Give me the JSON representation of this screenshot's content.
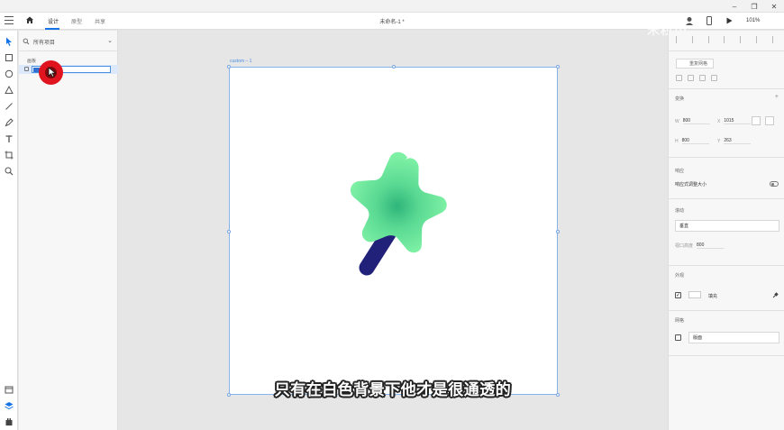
{
  "titlebar": {
    "window_controls": [
      "minimize-icon",
      "maximize-icon",
      "close-icon"
    ]
  },
  "menubar": {
    "tabs": [
      {
        "label": "设计",
        "active": true
      },
      {
        "label": "原型",
        "active": false
      },
      {
        "label": "共享",
        "active": false
      }
    ],
    "doc_title": "未命名-1 *",
    "zoom": "101%",
    "icons": [
      "menu-icon",
      "home-icon",
      "user-icon",
      "phone-icon",
      "play-icon"
    ]
  },
  "toolbar": {
    "tools": [
      "select-icon",
      "rectangle-icon",
      "ellipse-icon",
      "polygon-icon",
      "line-icon",
      "pen-icon",
      "text-icon",
      "artboard-icon",
      "zoom-icon"
    ],
    "bottom": [
      "assets-icon",
      "layers-icon",
      "plugins-icon"
    ]
  },
  "layers": {
    "search_placeholder": "所有项目",
    "section": "画板"
  },
  "canvas": {
    "artboard_label": "custom – 1",
    "subtitle": "只有在白色背景下他才是很通透的",
    "colors": {
      "star": "#7df0a4",
      "star_center": "#2fb57a",
      "stick": "#22217a"
    }
  },
  "watermark": "米粒小...",
  "props": {
    "repeat_grid": "重复网格",
    "transform_label": "变换",
    "w": "800",
    "x": "1015",
    "h": "800",
    "y": "263",
    "responsive_label": "响应",
    "responsive_resize": "响应式调整大小",
    "scroll_label": "滚动",
    "scroll_value": "垂直",
    "viewport_height_label": "视口高度",
    "viewport_height": "800",
    "appearance_label": "外观",
    "fill_label": "填充",
    "grid_label": "网格",
    "grid_value": "版面"
  }
}
